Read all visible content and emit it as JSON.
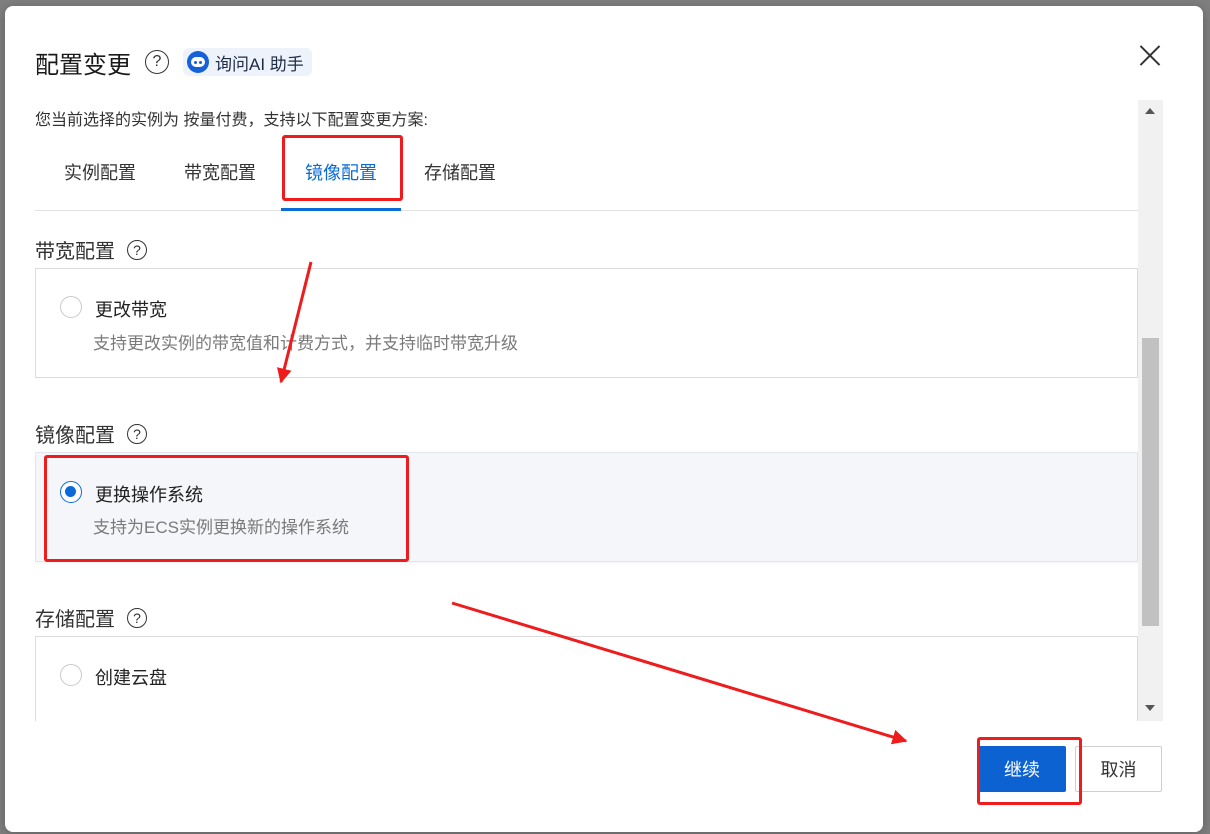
{
  "dialog": {
    "title": "配置变更",
    "ai_assistant": "询问AI 助手",
    "help_glyph": "?",
    "intro": "您当前选择的实例为 按量付费，支持以下配置变更方案:"
  },
  "tabs": [
    {
      "label": "实例配置"
    },
    {
      "label": "带宽配置"
    },
    {
      "label": "镜像配置",
      "active": true
    },
    {
      "label": "存储配置"
    }
  ],
  "sections": {
    "bandwidth": {
      "title": "带宽配置",
      "option_title": "更改带宽",
      "option_desc": "支持更改实例的带宽值和计费方式，并支持临时带宽升级",
      "checked": false
    },
    "image": {
      "title": "镜像配置",
      "option_title": "更换操作系统",
      "option_desc": "支持为ECS实例更换新的操作系统",
      "checked": true
    },
    "storage": {
      "title": "存储配置",
      "option_title": "创建云盘",
      "checked": false
    }
  },
  "footer": {
    "continue_label": "继续",
    "cancel_label": "取消"
  },
  "colors": {
    "accent": "#0b6bd6",
    "primary_button": "#0b62d0",
    "annotation_red": "#ee1c1c"
  },
  "icons": [
    "help-icon",
    "ai-assistant-icon",
    "close-icon",
    "scroll-up-icon",
    "scroll-down-icon"
  ]
}
